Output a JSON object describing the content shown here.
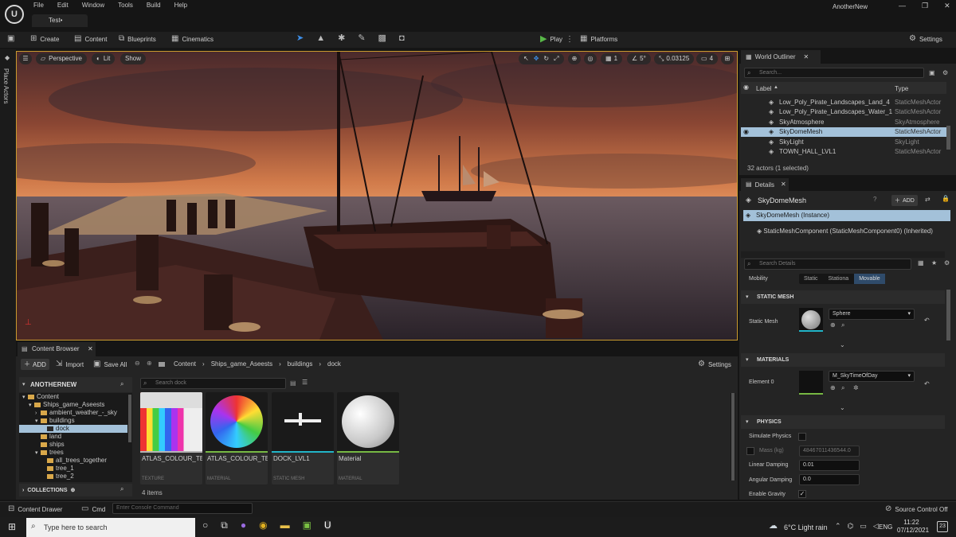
{
  "window": {
    "menu": [
      "File",
      "Edit",
      "Window",
      "Tools",
      "Build",
      "Help"
    ],
    "doc_tab": "Test•",
    "project_name": "AnotherNew"
  },
  "toolbar": {
    "create": "Create",
    "content": "Content",
    "blueprints": "Blueprints",
    "cinematics": "Cinematics",
    "play": "Play",
    "platforms": "Platforms",
    "settings": "Settings"
  },
  "left_strip": {
    "label": "Place Actors"
  },
  "viewport": {
    "perspective": "Perspective",
    "lit": "Lit",
    "show": "Show",
    "grid_size": "1",
    "rotation_snap": "5°",
    "scale_snap": "0.03125",
    "camera_speed": "4"
  },
  "content_browser": {
    "tab": "Content Browser",
    "add": "ADD",
    "import": "Import",
    "save_all": "Save All",
    "breadcrumb": [
      "Content",
      "Ships_game_Aseests",
      "buildings",
      "dock"
    ],
    "settings": "Settings",
    "root": "ANOTHERNEW",
    "search_placeholder": "Search dock",
    "tree": [
      {
        "label": "Content",
        "depth": 0,
        "open": true
      },
      {
        "label": "Ships_game_Aseests",
        "depth": 1,
        "open": true
      },
      {
        "label": "ambient_weather_-_sky",
        "depth": 2,
        "open": false
      },
      {
        "label": "buildings",
        "depth": 2,
        "open": true
      },
      {
        "label": "dock",
        "depth": 3,
        "selected": true
      },
      {
        "label": "land",
        "depth": 2
      },
      {
        "label": "ships",
        "depth": 2
      },
      {
        "label": "trees",
        "depth": 2,
        "open": true
      },
      {
        "label": "all_trees_together",
        "depth": 3
      },
      {
        "label": "tree_1",
        "depth": 3
      },
      {
        "label": "tree_2",
        "depth": 3
      }
    ],
    "collections": "COLLECTIONS",
    "assets": [
      {
        "name": "ATLAS_COLOUR_TEX",
        "type": "TEXTURE",
        "color": "#b5b5b5"
      },
      {
        "name": "ATLAS_COLOUR_TEX_Mat",
        "type": "MATERIAL",
        "color": "#77b843"
      },
      {
        "name": "DOCK_LVL1",
        "type": "STATIC MESH",
        "color": "#22b5c8"
      },
      {
        "name": "Material",
        "type": "MATERIAL",
        "color": "#77b843"
      }
    ],
    "item_count": "4 items"
  },
  "outliner": {
    "tab": "World Outliner",
    "search_placeholder": "Search...",
    "col_label": "Label",
    "col_type": "Type",
    "rows": [
      {
        "label": "Low_Poly_Pirate_Landscapes_Land_4",
        "type": "StaticMeshActor"
      },
      {
        "label": "Low_Poly_Pirate_Landscapes_Water_1",
        "type": "StaticMeshActor"
      },
      {
        "label": "SkyAtmosphere",
        "type": "SkyAtmosphere"
      },
      {
        "label": "SkyDomeMesh",
        "type": "StaticMeshActor",
        "selected": true
      },
      {
        "label": "SkyLight",
        "type": "SkyLight"
      },
      {
        "label": "TOWN_HALL_LVL1",
        "type": "StaticMeshActor"
      }
    ],
    "footer": "32 actors (1 selected)"
  },
  "details": {
    "tab": "Details",
    "actor_name": "SkyDomeMesh",
    "add": "ADD",
    "instance": "SkyDomeMesh (Instance)",
    "component": "StaticMeshComponent (StaticMeshComponent0) (Inherited)",
    "search_placeholder": "Search Details",
    "mobility_label": "Mobility",
    "mobility_options": [
      "Static",
      "Stationa",
      "Movable"
    ],
    "section_static_mesh": "STATIC MESH",
    "static_mesh_label": "Static Mesh",
    "static_mesh_value": "Sphere",
    "section_materials": "MATERIALS",
    "element0_label": "Element 0",
    "element0_value": "M_SkyTimeOfDay",
    "section_physics": "PHYSICS",
    "simulate_physics": "Simulate Physics",
    "mass_label": "Mass (kg)",
    "mass_value": "48467011436544.0",
    "linear_damping_label": "Linear Damping",
    "linear_damping_value": "0.01",
    "angular_damping_label": "Angular Damping",
    "angular_damping_value": "0.0",
    "enable_gravity": "Enable Gravity"
  },
  "statusbar": {
    "content_drawer": "Content Drawer",
    "cmd": "Cmd",
    "console_placeholder": "Enter Console Command",
    "source_control": "Source Control Off"
  },
  "taskbar": {
    "search_placeholder": "Type here to search",
    "weather": "6°C  Light rain",
    "lang": "ENG",
    "time": "11:22",
    "date": "07/12/2021",
    "notifications": "23"
  },
  "colors": {
    "accent_blue": "#2f7fd0",
    "selection": "#a3c1d9",
    "viewport_border": "#c99a2e",
    "play_green": "#58b848"
  }
}
